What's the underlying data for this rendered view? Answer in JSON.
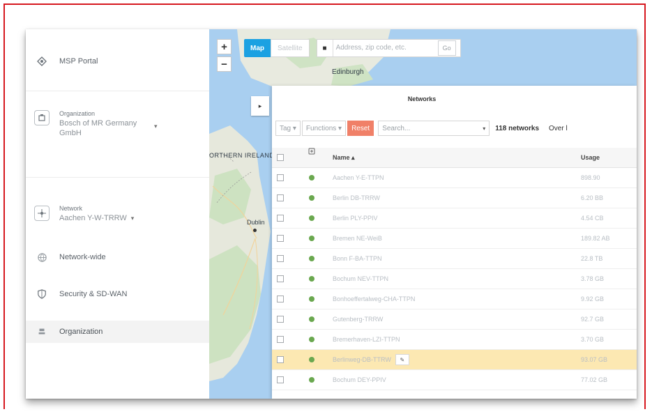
{
  "sidebar": {
    "msp_portal": "MSP Portal",
    "organization_label": "Organization",
    "organization_value": "Bosch of MR Germany GmbH",
    "network_label": "Network",
    "network_value": "Aachen Y-W-TRRW",
    "network_wide": "Network-wide",
    "security_sdwan": "Security & SD-WAN",
    "organization": "Organization"
  },
  "map": {
    "zoom_in": "+",
    "zoom_out": "−",
    "map_button": "Map",
    "satellite_button": "Satellite",
    "search_placeholder": "Address, zip code, etc.",
    "go_button": "Go",
    "labels": {
      "edinburgh": "Edinburgh",
      "northern_ireland": "ORTHERN IRELAND",
      "dublin": "Dublin"
    }
  },
  "panel": {
    "title": "Networks",
    "tag_filter": "Tag ▾",
    "functions_filter": "Functions ▾",
    "reset_button": "Reset",
    "search_placeholder": "Search...",
    "network_count": "118 networks",
    "extra": "Over l",
    "columns": {
      "name": "Name ▴",
      "usage": "Usage"
    }
  },
  "rows": [
    {
      "name": "Aachen Y-E-TTPN",
      "usage": "898.90"
    },
    {
      "name": "Berlin DB-TRRW",
      "usage": "6.20 BB"
    },
    {
      "name": "Berlin PLY-PPIV",
      "usage": "4.54 CB"
    },
    {
      "name": "Bremen NE-WeiB",
      "usage": "189.82 AB"
    },
    {
      "name": "Bonn F-BA-TTPN",
      "usage": "22.8 TB"
    },
    {
      "name": "Bochum NEV-TTPN",
      "usage": "3.78 GB"
    },
    {
      "name": "Bonhoeffertalweg-CHA-TTPN",
      "usage": "9.92 GB"
    },
    {
      "name": "Gutenberg-TRRW",
      "usage": "92.7 GB"
    },
    {
      "name": "Bremerhaven-LZI-TTPN",
      "usage": "3.70 GB"
    },
    {
      "name": "Berlinweg-DB-TTRW",
      "usage": "93.07 GB"
    },
    {
      "name": "Bochum DEY-PPIV",
      "usage": "77.02 GB"
    }
  ],
  "highlight_index": 9,
  "colors": {
    "accent": "#1ba1e2",
    "reset": "#f08068",
    "highlight": "#fce8b2",
    "status": "#6aa84f",
    "frame": "#d6171e"
  }
}
